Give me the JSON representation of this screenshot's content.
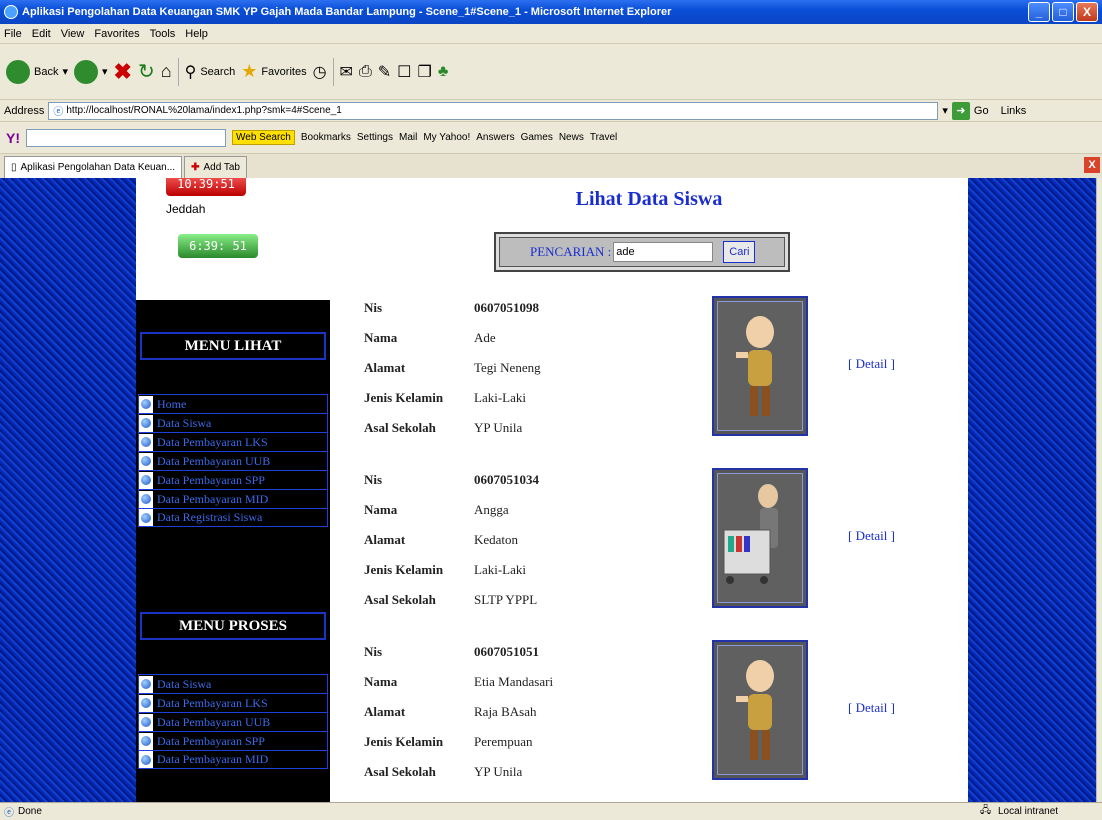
{
  "window": {
    "title": "Aplikasi Pengolahan Data Keuangan SMK YP Gajah Mada Bandar Lampung - Scene_1#Scene_1 - Microsoft Internet Explorer"
  },
  "menubar": [
    "File",
    "Edit",
    "View",
    "Favorites",
    "Tools",
    "Help"
  ],
  "toolbar": {
    "back": "Back",
    "search": "Search",
    "favorites": "Favorites"
  },
  "address": {
    "label": "Address",
    "url": "http://localhost/RONAL%20lama/index1.php?smk=4#Scene_1",
    "go": "Go",
    "links": "Links"
  },
  "yahoo": {
    "web_search": "Web Search",
    "bookmarks": "Bookmarks",
    "settings": "Settings",
    "mail": "Mail",
    "myyahoo": "My Yahoo!",
    "answers": "Answers",
    "games": "Games",
    "news": "News",
    "travel": "Travel"
  },
  "tabs": {
    "active": "Aplikasi Pengolahan Data Keuan...",
    "add": "Add Tab"
  },
  "clock": {
    "time_top": "10:39:51",
    "city": "Jeddah",
    "time_bottom": "6:39: 51"
  },
  "sidebar": {
    "menu_lihat": "MENU LIHAT",
    "lihat_items": [
      "Home",
      "Data Siswa",
      "Data Pembayaran LKS",
      "Data Pembayaran UUB",
      "Data Pembayaran SPP",
      "Data Pembayaran MID",
      "Data Registrasi Siswa"
    ],
    "menu_proses": "MENU PROSES",
    "proses_items": [
      "Data Siswa",
      "Data Pembayaran LKS",
      "Data Pembayaran UUB",
      "Data Pembayaran SPP",
      "Data Pembayaran MID"
    ]
  },
  "main": {
    "title": "Lihat Data Siswa",
    "search_label": "PENCARIAN :",
    "search_value": "ade",
    "search_button": "Cari",
    "field_labels": {
      "nis": "Nis",
      "nama": "Nama",
      "alamat": "Alamat",
      "jk": "Jenis Kelamin",
      "asal": "Asal Sekolah"
    },
    "detail_link": "[ Detail ]",
    "records": [
      {
        "nis": "0607051098",
        "nama": "Ade",
        "alamat": "Tegi Neneng",
        "jk": "Laki-Laki",
        "asal": "YP Unila"
      },
      {
        "nis": "0607051034",
        "nama": "Angga",
        "alamat": "Kedaton",
        "jk": "Laki-Laki",
        "asal": "SLTP YPPL"
      },
      {
        "nis": "0607051051",
        "nama": "Etia Mandasari",
        "alamat": "Raja BAsah",
        "jk": "Perempuan",
        "asal": "YP Unila"
      }
    ]
  },
  "status": {
    "left": "Done",
    "right": "Local intranet"
  }
}
